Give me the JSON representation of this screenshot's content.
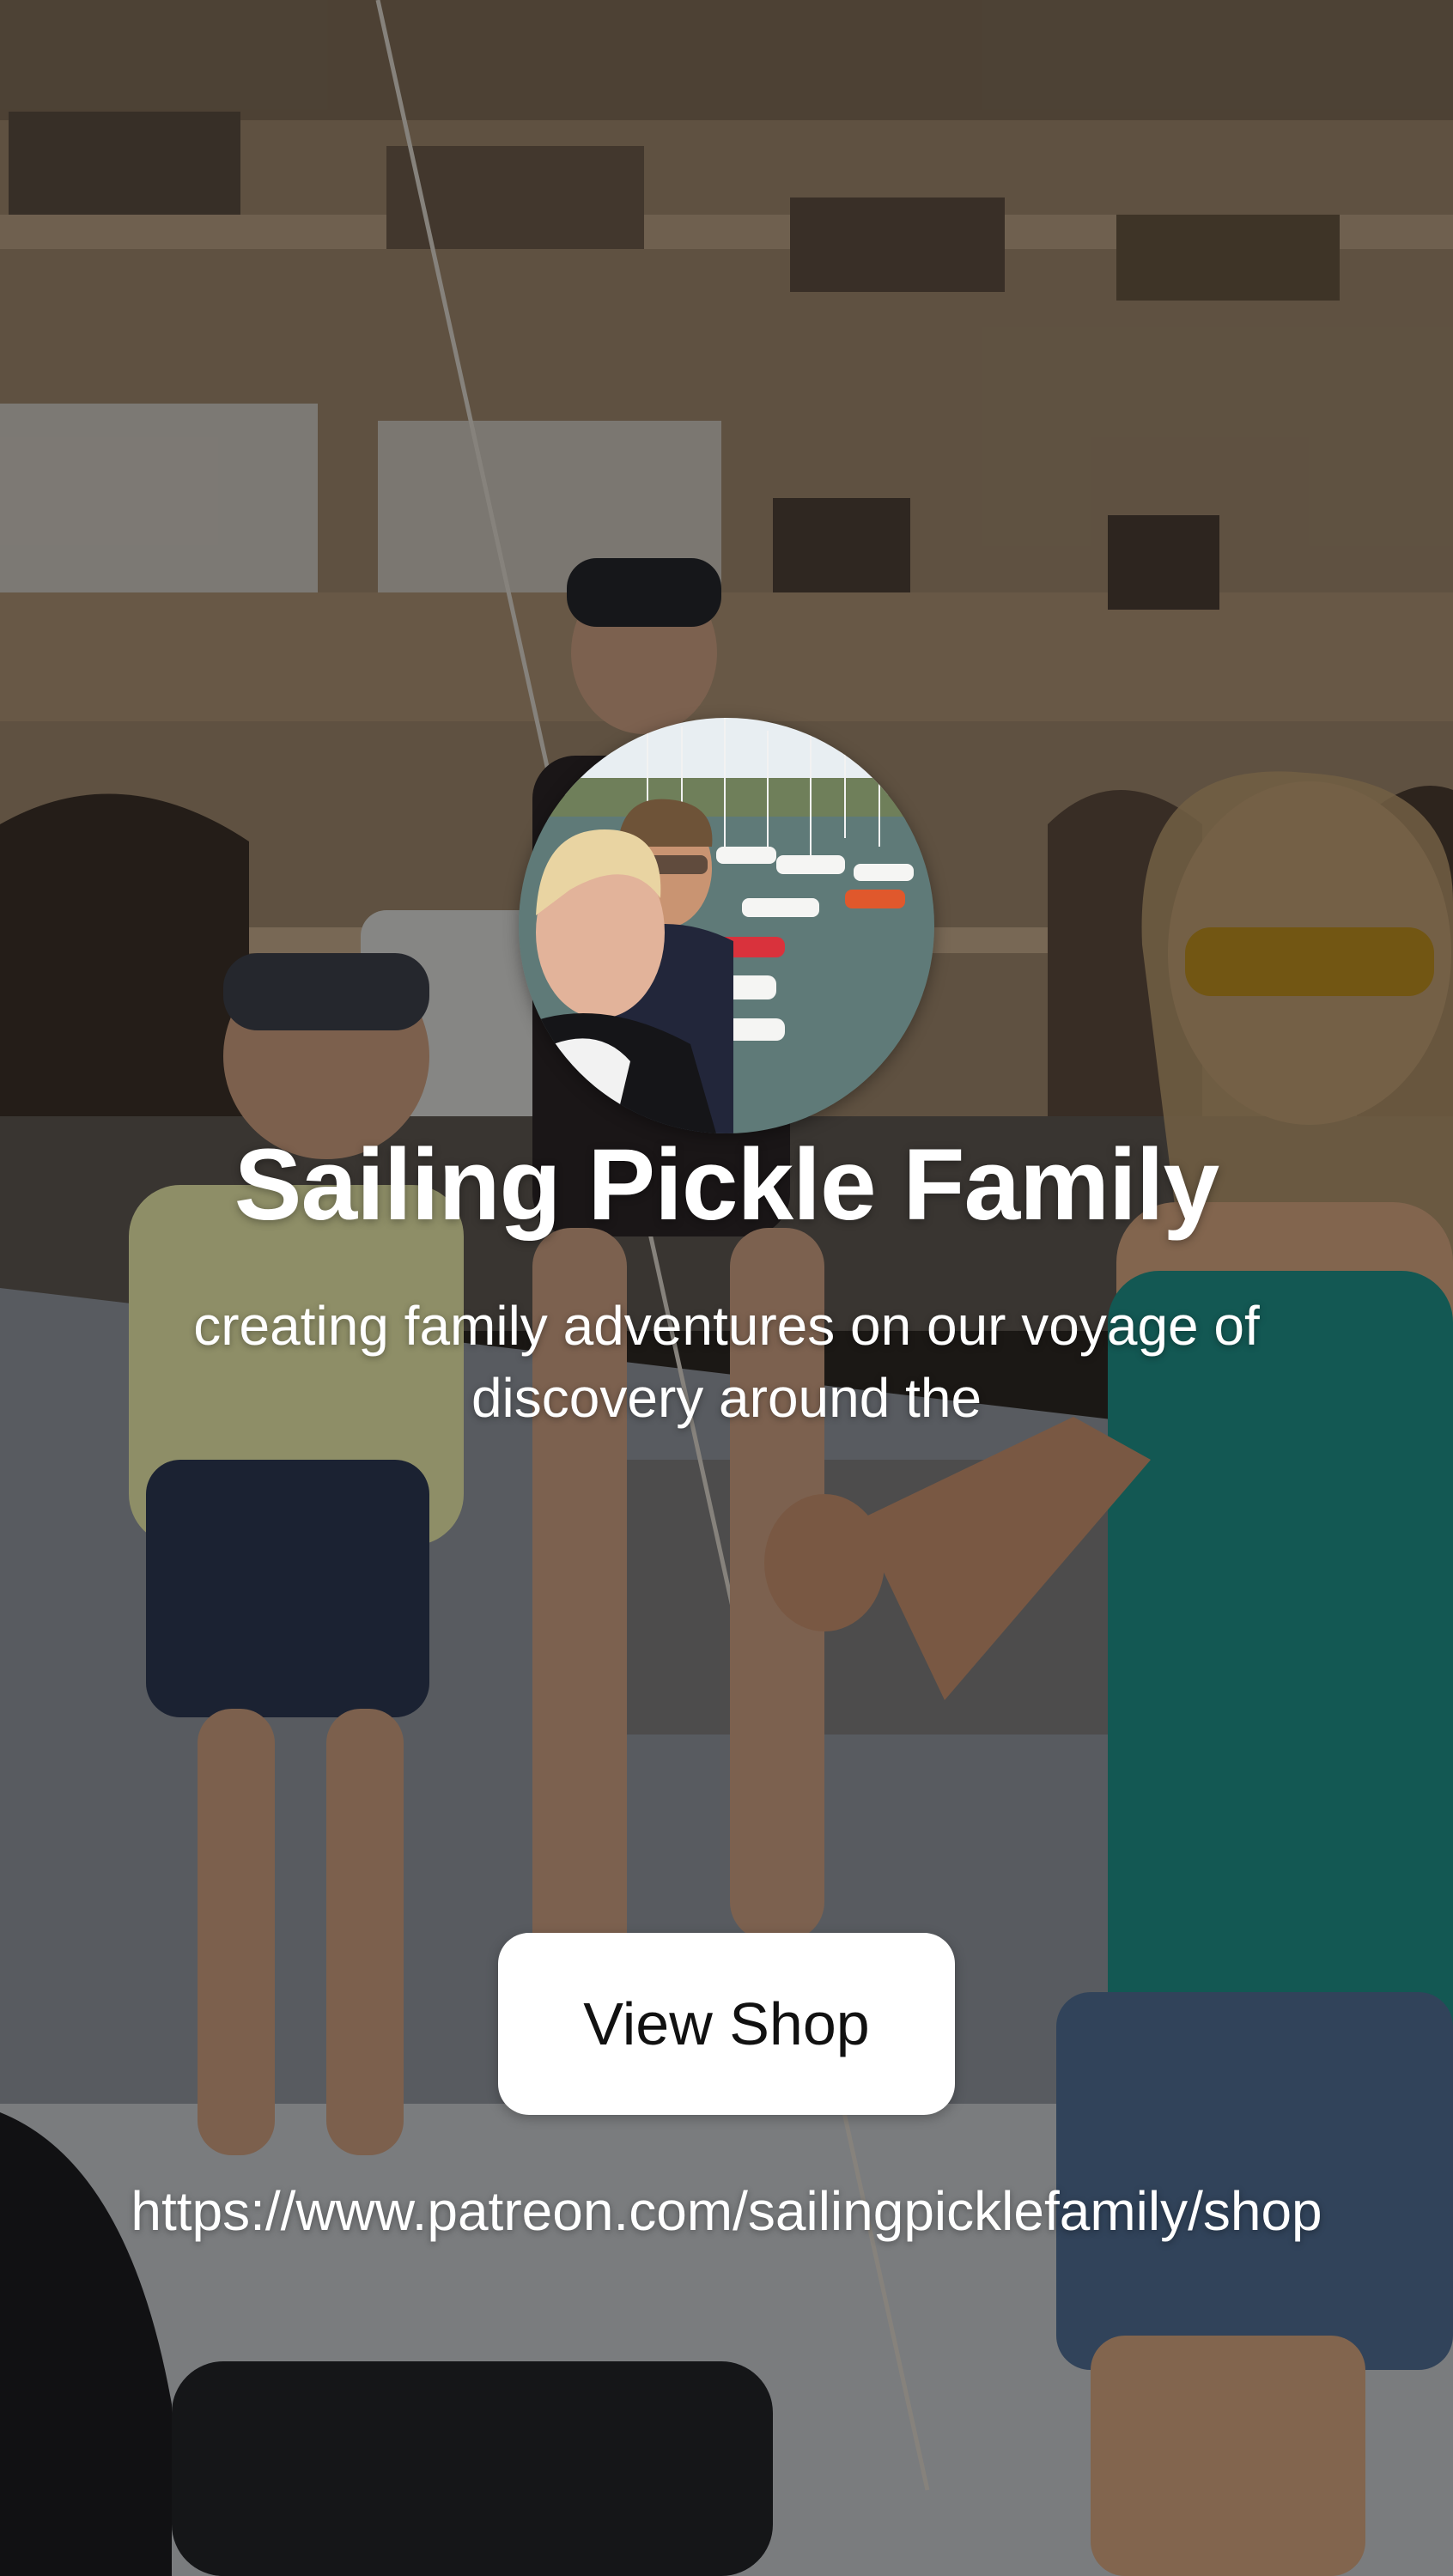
{
  "profile": {
    "name": "Sailing Pickle Family",
    "tagline": "creating family adventures on our voyage of discovery around the",
    "avatar_alt": "avatar-photo"
  },
  "shop": {
    "button_label": "View Shop",
    "url": "https://www.patreon.com/sailingpicklefamily/shop"
  },
  "colors": {
    "text": "#ffffff",
    "button_bg": "#ffffff",
    "button_text": "#111111",
    "overlay": "rgba(0,0,0,0.38)"
  }
}
